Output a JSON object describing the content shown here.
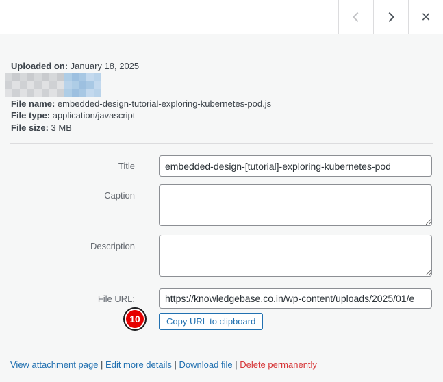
{
  "colors": {
    "accent": "#2271b1",
    "danger": "#d63638",
    "badge_red": "#e60000",
    "border": "#dcdcde",
    "input_border": "#8c8f94",
    "label_gray": "#646970",
    "mosaic_grays": [
      "#d6d8da",
      "#cfd1d4",
      "#dbdcde",
      "#c9cbce",
      "#e0e1e3",
      "#d2d4d7"
    ],
    "mosaic_blues": [
      "#a8c8e4",
      "#b9d3ea",
      "#9dc0e0",
      "#c3d9ee",
      "#aecde6"
    ]
  },
  "header": {
    "nav": {
      "prev_icon": "chevron-left",
      "next_icon": "chevron-right",
      "close_icon": "✕"
    }
  },
  "details": {
    "uploaded_on_label": "Uploaded on:",
    "uploaded_on_value": "January 18, 2025",
    "file_name_label": "File name:",
    "file_name_value": "embedded-design-tutorial-exploring-kubernetes-pod.js",
    "file_type_label": "File type:",
    "file_type_value": "application/javascript",
    "file_size_label": "File size:",
    "file_size_value": "3 MB"
  },
  "form": {
    "title": {
      "label": "Title",
      "value": "embedded-design-[tutorial]-exploring-kubernetes-pod"
    },
    "caption": {
      "label": "Caption",
      "value": ""
    },
    "description": {
      "label": "Description",
      "value": ""
    },
    "file_url": {
      "label": "File URL:",
      "value": "https://knowledgebase.co.in/wp-content/uploads/2025/01/e"
    },
    "copy_button_label": "Copy URL to clipboard",
    "badge_number": "10"
  },
  "actions": {
    "separator": "|",
    "links": [
      {
        "label": "View attachment page"
      },
      {
        "label": "Edit more details"
      },
      {
        "label": "Download file"
      },
      {
        "label": "Delete permanently"
      }
    ]
  }
}
